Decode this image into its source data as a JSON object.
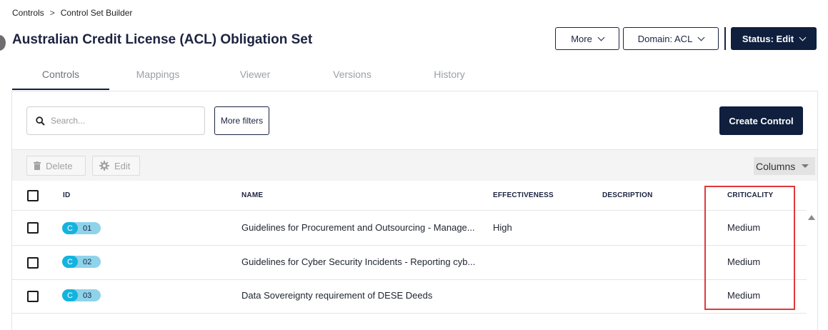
{
  "breadcrumb": {
    "root": "Controls",
    "separator": ">",
    "current": "Control Set Builder"
  },
  "page": {
    "title": "Australian Credit License (ACL) Obligation Set"
  },
  "header_actions": {
    "more_label": "More",
    "domain_label": "Domain: ACL",
    "status_label": "Status: Edit"
  },
  "tabs": [
    {
      "label": "Controls",
      "active": true
    },
    {
      "label": "Mappings",
      "active": false
    },
    {
      "label": "Viewer",
      "active": false
    },
    {
      "label": "Versions",
      "active": false
    },
    {
      "label": "History",
      "active": false
    }
  ],
  "search": {
    "placeholder": "Search...",
    "value": ""
  },
  "filters_label": "More filters",
  "create_label": "Create Control",
  "toolbar": {
    "delete_label": "Delete",
    "edit_label": "Edit",
    "columns_label": "Columns"
  },
  "table": {
    "headers": {
      "id": "ID",
      "name": "NAME",
      "effectiveness": "EFFECTIVENESS",
      "description": "DESCRIPTION",
      "criticality": "CRITICALITY"
    },
    "rows": [
      {
        "badge": "C",
        "id": "01",
        "name": "Guidelines for Procurement and Outsourcing - Manage...",
        "effectiveness": "High",
        "description": "",
        "criticality": "Medium"
      },
      {
        "badge": "C",
        "id": "02",
        "name": "Guidelines for Cyber Security Incidents - Reporting cyb...",
        "effectiveness": "",
        "description": "",
        "criticality": "Medium"
      },
      {
        "badge": "C",
        "id": "03",
        "name": "Data Sovereignty requirement of DESE Deeds",
        "effectiveness": "",
        "description": "",
        "criticality": "Medium"
      }
    ]
  },
  "colors": {
    "navy": "#0f1f3d",
    "badge_dark": "#14b3df",
    "badge_light": "#8fd3ea",
    "highlight": "#e0393a"
  },
  "icons": [
    "search-icon",
    "trash-icon",
    "gear-icon",
    "chevron-down-icon",
    "caret-down-icon",
    "scroll-up-icon"
  ]
}
